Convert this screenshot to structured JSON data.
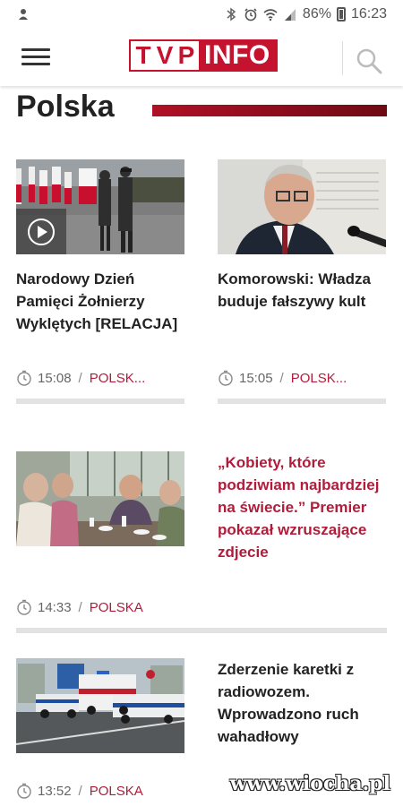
{
  "status_bar": {
    "battery_percent": "86%",
    "time": "16:23",
    "icons": [
      "notification-icon",
      "bluetooth-icon",
      "alarm-icon",
      "wifi-icon",
      "signal-icon",
      "battery-icon"
    ]
  },
  "header": {
    "logo_tvp": [
      "T",
      "V",
      "P"
    ],
    "logo_info": "INFO",
    "menu_icon": "hamburger-icon",
    "search_icon": "search-icon"
  },
  "section": {
    "title": "Polska"
  },
  "articles": [
    {
      "headline": "Narodowy Dzień Pamięci Żołnierzy Wyklętych [RELACJA]",
      "time": "15:08",
      "category": "POLSK...",
      "video": true
    },
    {
      "headline": "Komorowski: Władza buduje fałszywy kult",
      "time": "15:05",
      "category": "POLSK..."
    },
    {
      "headline": "„Kobiety, które podziwiam najbardziej na świecie.” Premier pokazał wzruszające zdjecie",
      "time": "14:33",
      "category": "POLSKA"
    },
    {
      "headline": "Zderzenie karetki z radiowozem. Wprowadzono ruch wahadłowy",
      "time": "13:52",
      "category": "POLSKA"
    }
  ],
  "watermark": "www.wiocha.pl",
  "colors": {
    "brand_red": "#c4122f",
    "category_red": "#b01c3a"
  }
}
